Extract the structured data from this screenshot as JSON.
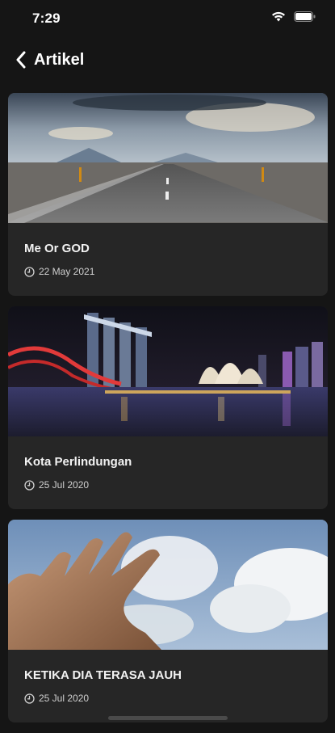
{
  "status_bar": {
    "time": "7:29"
  },
  "header": {
    "title": "Artikel",
    "back_icon": "chevron-left-icon"
  },
  "articles": [
    {
      "title": "Me Or GOD",
      "date": "22 May 2021",
      "image": "road-landscape"
    },
    {
      "title": "Kota Perlindungan",
      "date": "25 Jul 2020",
      "image": "city-night-skyline"
    },
    {
      "title": "KETIKA DIA TERASA JAUH",
      "date": "25 Jul 2020",
      "image": "hand-reaching-sky"
    }
  ],
  "colors": {
    "background": "#151515",
    "card": "#262626",
    "text": "#ffffff",
    "muted": "#cfcfcf"
  }
}
